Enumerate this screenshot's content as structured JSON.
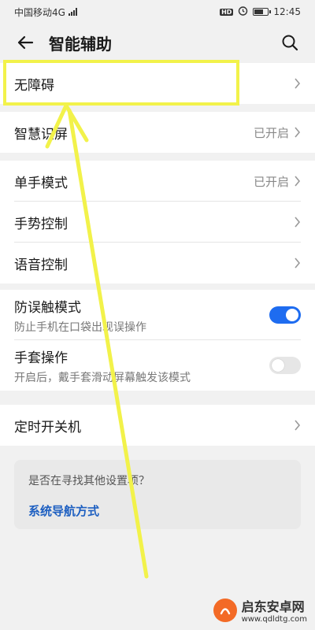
{
  "status_bar": {
    "carrier": "中国移动4G",
    "net_badge": "4G",
    "hd": "HD",
    "time": "12:45",
    "battery_level": 0.7
  },
  "header": {
    "title": "智能辅助"
  },
  "sections": {
    "accessibility": {
      "label": "无障碍"
    },
    "smart_screen": {
      "label": "智慧识屏",
      "status": "已开启"
    },
    "one_hand": {
      "label": "单手模式",
      "status": "已开启"
    },
    "gesture": {
      "label": "手势控制"
    },
    "voice": {
      "label": "语音控制"
    },
    "anti_mistouch": {
      "label": "防误触模式",
      "desc": "防止手机在口袋出现误操作",
      "enabled": true
    },
    "glove": {
      "label": "手套操作",
      "desc": "开启后，戴手套滑动屏幕触发该模式",
      "enabled": false
    },
    "scheduled_power": {
      "label": "定时开关机"
    }
  },
  "suggestion": {
    "question": "是否在寻找其他设置项？",
    "link": "系统导航方式"
  },
  "colors": {
    "accent": "#1e6cf0",
    "highlight": "#f2f24a",
    "link": "#1d5fc1"
  },
  "watermark": {
    "name": "启东安卓网",
    "url": "www.qdldtg.com"
  }
}
